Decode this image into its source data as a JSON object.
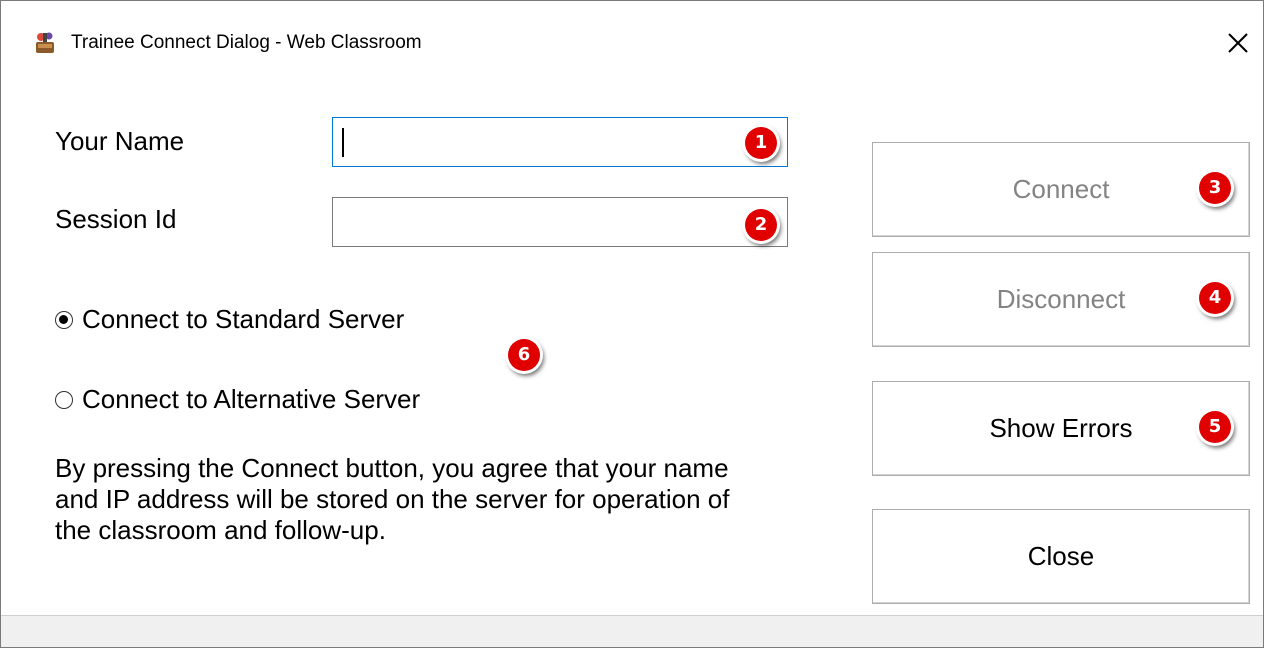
{
  "window": {
    "title": "Trainee Connect Dialog - Web Classroom"
  },
  "form": {
    "name_label": "Your Name",
    "name_value": "",
    "session_label": "Session Id",
    "session_value": ""
  },
  "radios": {
    "standard_label": "Connect to Standard Server",
    "standard_selected": true,
    "alternative_label": "Connect to Alternative Server",
    "alternative_selected": false
  },
  "consent_text": "By pressing the Connect button, you agree that your name and IP address will be stored on the server for operation of the classroom and follow-up.",
  "buttons": {
    "connect": "Connect",
    "connect_enabled": false,
    "disconnect": "Disconnect",
    "disconnect_enabled": false,
    "show_errors": "Show Errors",
    "close": "Close"
  },
  "badges": [
    "1",
    "2",
    "3",
    "4",
    "5",
    "6"
  ],
  "colors": {
    "badge": "#e00000",
    "focus_border": "#0078d7",
    "disabled_text": "#838383"
  }
}
